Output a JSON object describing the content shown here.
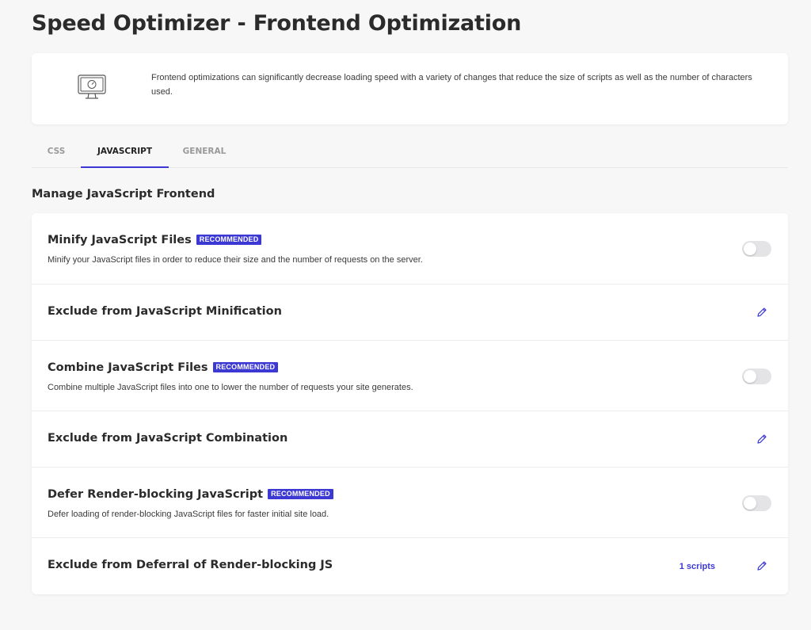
{
  "page": {
    "title": "Speed Optimizer - Frontend Optimization"
  },
  "intro": {
    "icon": "monitor-speed-icon",
    "text": "Frontend optimizations can significantly decrease loading speed with a variety of changes that reduce the size of scripts as well as the number of characters used."
  },
  "tabs": [
    {
      "label": "CSS",
      "active": false
    },
    {
      "label": "JAVASCRIPT",
      "active": true
    },
    {
      "label": "GENERAL",
      "active": false
    }
  ],
  "section": {
    "title": "Manage JavaScript Frontend"
  },
  "settings": {
    "minify": {
      "title": "Minify JavaScript Files",
      "badge": "RECOMMENDED",
      "description": "Minify your JavaScript files in order to reduce their size and the number of requests on the server.",
      "enabled": false
    },
    "exclude_minify": {
      "title": "Exclude from JavaScript Minification"
    },
    "combine": {
      "title": "Combine JavaScript Files",
      "badge": "RECOMMENDED",
      "description": "Combine multiple JavaScript files into one to lower the number of requests your site generates.",
      "enabled": false
    },
    "exclude_combine": {
      "title": "Exclude from JavaScript Combination"
    },
    "defer": {
      "title": "Defer Render-blocking JavaScript",
      "badge": "RECOMMENDED",
      "description": "Defer loading of render-blocking JavaScript files for faster initial site load.",
      "enabled": false
    },
    "exclude_defer": {
      "title": "Exclude from Deferral of Render-blocking JS",
      "count_label": "1 scripts"
    }
  },
  "colors": {
    "accent": "#3c38d4",
    "background": "#f7f7f8",
    "card": "#ffffff",
    "toggle_off": "#e4e4e6"
  }
}
